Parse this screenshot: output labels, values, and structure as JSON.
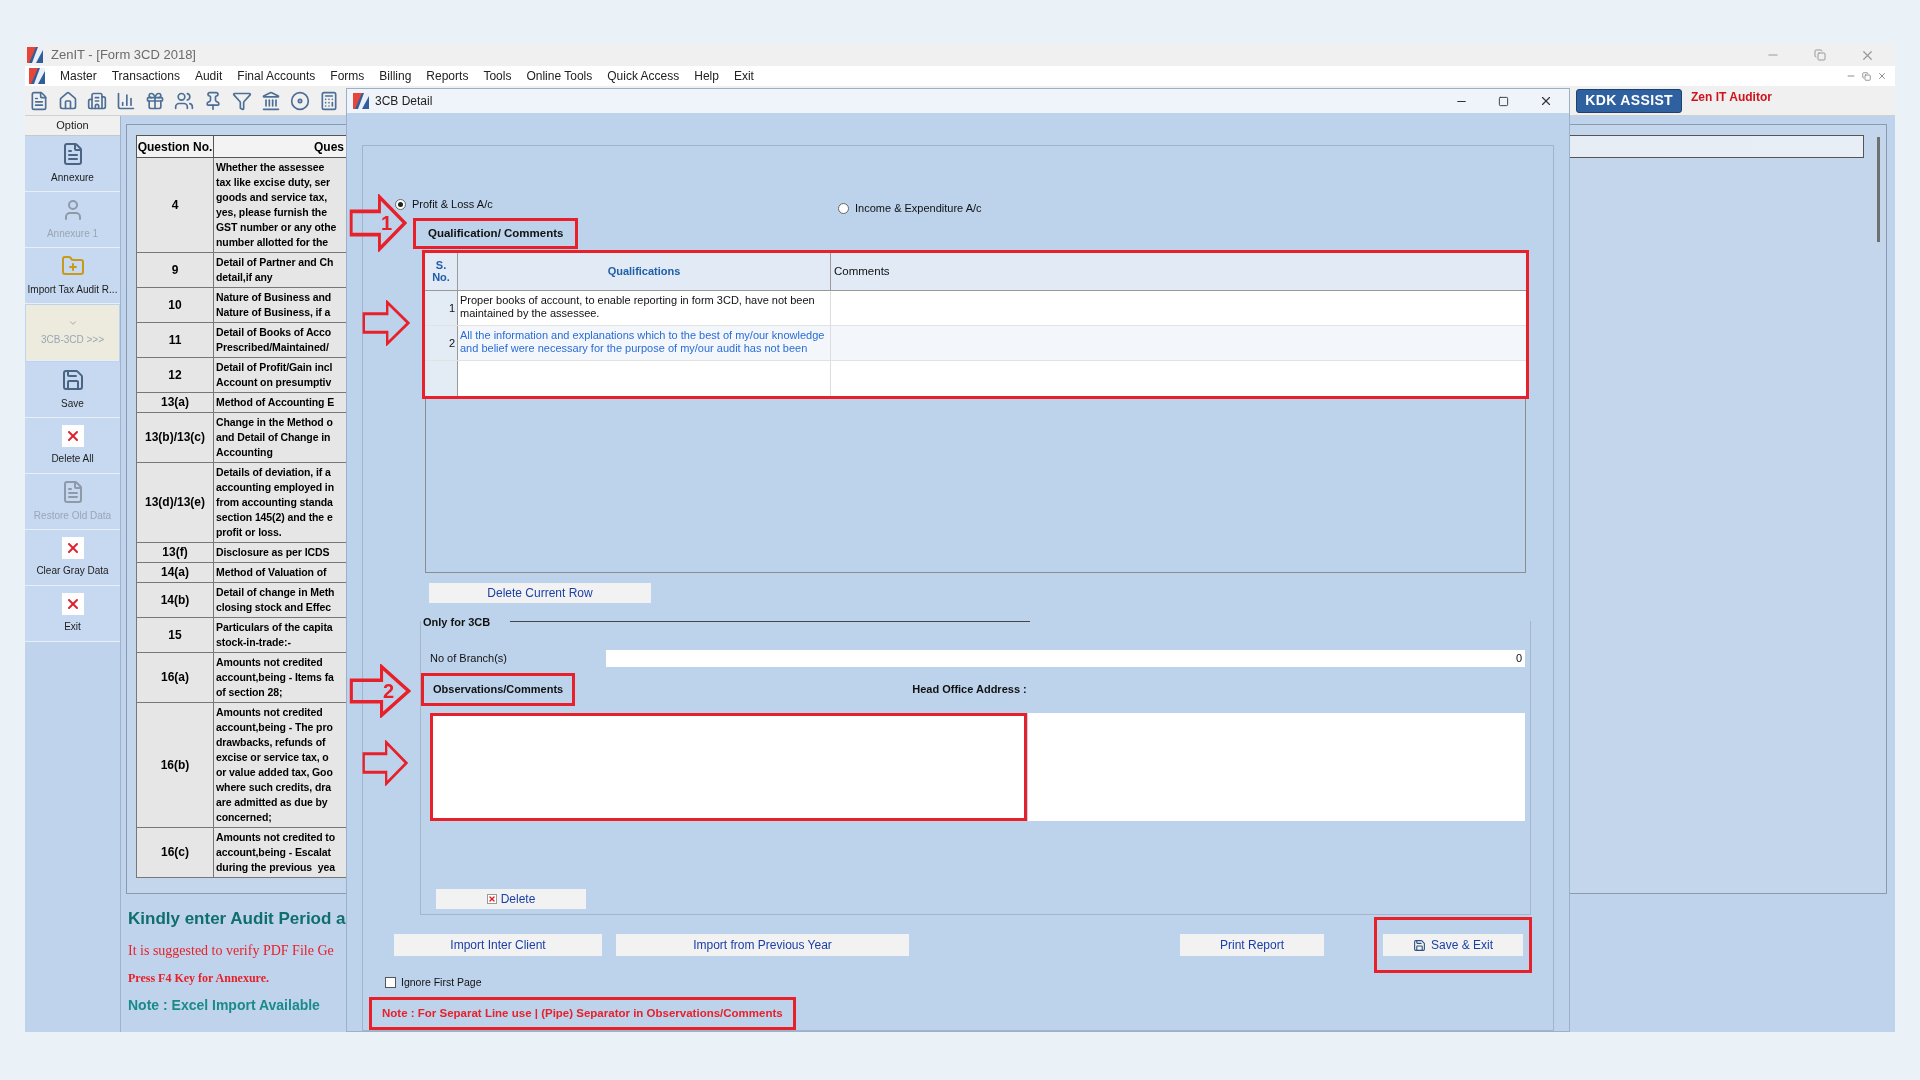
{
  "main_window": {
    "title": "ZenIT - [Form 3CD 2018]",
    "menu": [
      "Master",
      "Transactions",
      "Audit",
      "Final Accounts",
      "Forms",
      "Billing",
      "Reports",
      "Tools",
      "Online Tools",
      "Quick Access",
      "Help",
      "Exit"
    ],
    "kdk_button": "KDK ASSIST",
    "brand": "Zen IT Auditor",
    "sidebar": {
      "header": "Option",
      "items": [
        {
          "label": "Annexure",
          "kind": "annexure",
          "disabled": false
        },
        {
          "label": "Annexure 1",
          "kind": "person",
          "disabled": true
        },
        {
          "label": "Import Tax Audit R...",
          "kind": "folder",
          "disabled": false
        },
        {
          "label": "3CB-3CD >>>",
          "kind": "dropdown",
          "disabled": true
        },
        {
          "label": "Save",
          "kind": "save",
          "disabled": false
        },
        {
          "label": "Delete All",
          "kind": "delete",
          "disabled": false
        },
        {
          "label": "Restore Old Data",
          "kind": "document",
          "disabled": true
        },
        {
          "label": "Clear Gray Data",
          "kind": "delete",
          "disabled": false
        },
        {
          "label": "Exit",
          "kind": "delete",
          "disabled": false
        }
      ]
    },
    "question_table": {
      "columns": [
        "Question No.",
        "Ques"
      ],
      "rows": [
        {
          "no": "4",
          "lines": [
            "Whether the assessee",
            "tax like excise duty, ser",
            "goods and service tax,",
            "yes, please furnish the",
            "GST number or any othe",
            "number allotted for the"
          ]
        },
        {
          "no": "9",
          "lines": [
            "Detail of Partner and Ch",
            "detail,if any"
          ]
        },
        {
          "no": "10",
          "lines": [
            "Nature of Business and",
            "Nature of Business, if a"
          ]
        },
        {
          "no": "11",
          "lines": [
            "Detail of Books of Acco",
            "Prescribed/Maintained/"
          ]
        },
        {
          "no": "12",
          "lines": [
            "Detail of Profit/Gain incl",
            "Account on presumptiv"
          ]
        },
        {
          "no": "13(a)",
          "lines": [
            "Method of Accounting E"
          ]
        },
        {
          "no": "13(b)/13(c)",
          "lines": [
            "Change in the Method o",
            "and Detail of Change in",
            "Accounting"
          ]
        },
        {
          "no": "13(d)/13(e)",
          "lines": [
            "Details of deviation, if a",
            "accounting employed in",
            "from accounting standa",
            "section 145(2) and the e",
            "profit or loss."
          ]
        },
        {
          "no": "13(f)",
          "lines": [
            "Disclosure as per ICDS"
          ]
        },
        {
          "no": "14(a)",
          "lines": [
            "Method of Valuation of"
          ]
        },
        {
          "no": "14(b)",
          "lines": [
            "Detail of change in Meth",
            "closing stock and Effec"
          ]
        },
        {
          "no": "15",
          "lines": [
            "Particulars of the capita",
            "stock-in-trade:-"
          ]
        },
        {
          "no": "16(a)",
          "lines": [
            "Amounts not credited",
            "account,being - Items fa",
            "of section 28;"
          ]
        },
        {
          "no": "16(b)",
          "lines": [
            "Amounts not credited",
            "account,being - The pro",
            "drawbacks, refunds of",
            "excise or service tax, o",
            "or value added tax, Goo",
            "where such credits, dra",
            "are admitted as due by",
            "concerned;"
          ]
        },
        {
          "no": "16(c)",
          "lines": [
            "Amounts not credited to",
            "account,being - Escalat",
            "during the previous  yea"
          ]
        }
      ]
    },
    "notes": [
      {
        "kind": "heading",
        "text": "Kindly enter Audit Period a"
      },
      {
        "kind": "warning",
        "text": "It is suggested to verify PDF File Ge"
      },
      {
        "kind": "hint",
        "text": "Press F4 Key for Annexure."
      },
      {
        "kind": "note",
        "text": "Note : Excel Import Available"
      }
    ]
  },
  "dialog": {
    "title": "3CB Detail",
    "account_type": [
      {
        "label": "Profit & Loss A/c",
        "selected": true
      },
      {
        "label": "Income & Expenditure A/c",
        "selected": false
      }
    ],
    "qualification_label": "Qualification/ Comments",
    "grid": {
      "columns": [
        "S. No.",
        "Qualifications",
        "Comments"
      ],
      "rows": [
        {
          "sno": "1",
          "qualification": "Proper books of account, to enable reporting in form 3CD, have not been maintained by the assessee.",
          "selected": false
        },
        {
          "sno": "2",
          "qualification": "All the information and explanations which to the best of my/our knowledge and belief were necessary for the purpose of my/our audit has not been",
          "selected": true
        }
      ]
    },
    "delete_row_button": "Delete Current Row",
    "group_title": "Only for 3CB",
    "branches": {
      "label": "No of Branch(s)",
      "value": "0"
    },
    "observations_label": "Observations/Comments",
    "head_office_label": "Head Office Address :",
    "delete_button": "Delete",
    "buttons": [
      {
        "label": "Import Inter Client",
        "kind": "plain"
      },
      {
        "label": "Import from Previous Year",
        "kind": "plain"
      },
      {
        "label": "Print Report",
        "kind": "plain"
      },
      {
        "label": "Save & Exit",
        "kind": "save"
      }
    ],
    "ignore_first_page": {
      "label": "Ignore First Page",
      "checked": false
    },
    "note": "Note : For Separat Line use | (Pipe) Separator in Observations/Comments"
  },
  "annotations": [
    {
      "label": "1"
    },
    {
      "label": "2"
    }
  ]
}
